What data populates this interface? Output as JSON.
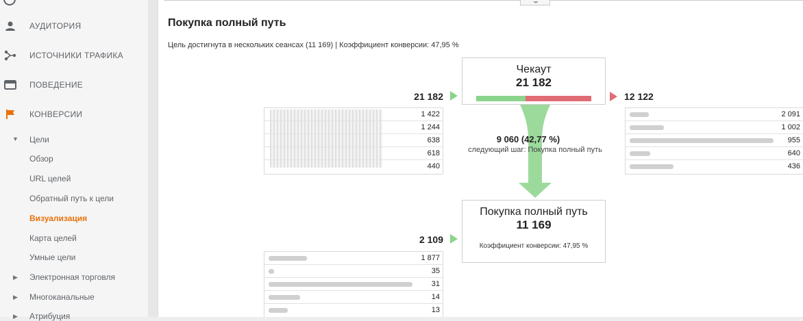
{
  "sidebar": {
    "items": [
      {
        "label": "Аудитория",
        "icon": "person-icon"
      },
      {
        "label": "Источники трафика",
        "icon": "fork-icon"
      },
      {
        "label": "Поведение",
        "icon": "window-icon"
      },
      {
        "label": "Конверсии",
        "icon": "flag-icon"
      }
    ],
    "goals_label": "Цели",
    "goals_sub": [
      "Обзор",
      "URL целей",
      "Обратный путь к цели",
      "Визуализация",
      "Карта целей",
      "Умные цели"
    ],
    "ecommerce_label": "Электронная торговля",
    "multichannel_label": "Многоканальные",
    "attribution_label": "Атрибуция"
  },
  "report": {
    "title": "Покупка полный путь",
    "subtitle": "Цель достигнута в нескольких сеансах (11 169) | Коэффициент конверсии: 47,95 %"
  },
  "step1": {
    "name": "Чекаут",
    "value": "21 182",
    "entrances": "21 182",
    "exits": "12 122",
    "continue_fraction": 0.4277
  },
  "flow": {
    "value": "9 060 (42,77 %)",
    "desc": "следующий шаг: Покупка полный путь"
  },
  "step2": {
    "name": "Покупка полный путь",
    "value": "11 169",
    "entrances": "2 109",
    "conversion_note": "Коэффициент конверсии: 47,95 %"
  },
  "sources_left": [
    "1 422",
    "1 244",
    "638",
    "618",
    "440"
  ],
  "sources_right": [
    "2 091",
    "1 002",
    "955",
    "640",
    "436"
  ],
  "sources_bottom": [
    "1 877",
    "35",
    "31",
    "14",
    "13"
  ],
  "colors": {
    "accent_orange": "#e8710a",
    "continue_green": "#8bd48b",
    "exit_red": "#e06c75"
  }
}
